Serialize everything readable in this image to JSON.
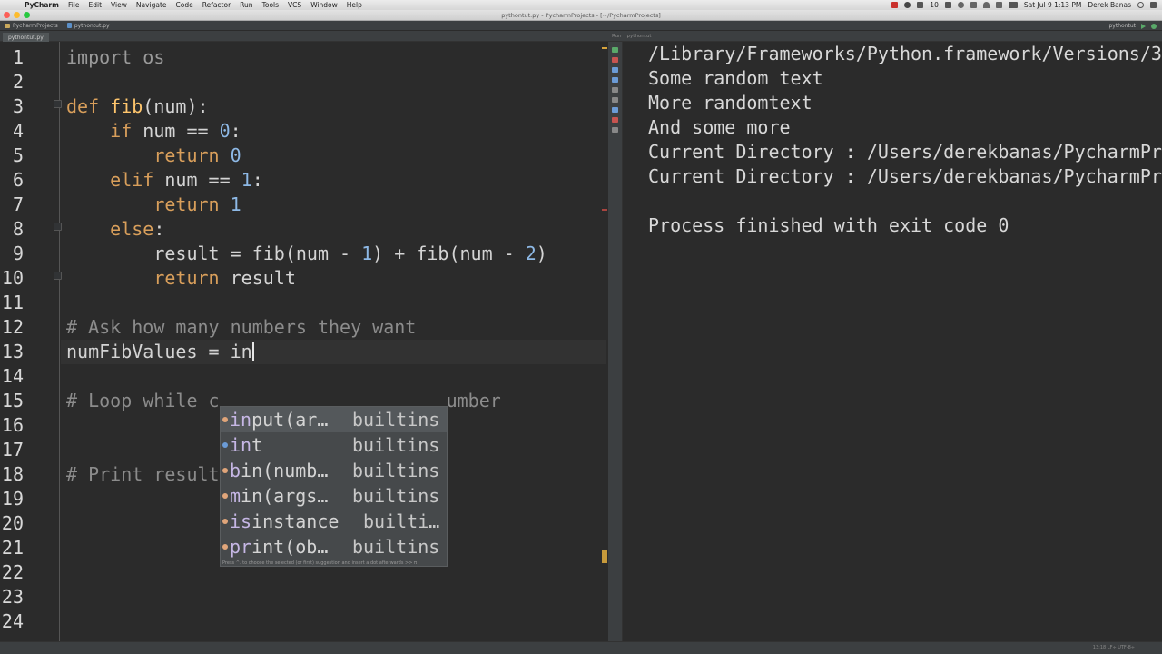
{
  "menubar": {
    "apple": "",
    "app_name": "PyCharm",
    "items": [
      "File",
      "Edit",
      "View",
      "Navigate",
      "Code",
      "Refactor",
      "Run",
      "Tools",
      "VCS",
      "Window",
      "Help"
    ],
    "status": {
      "badge": "10",
      "clock": "Sat Jul 9  1:13 PM",
      "user": "Derek Banas"
    }
  },
  "window": {
    "title": "pythontut.py - PycharmProjects - [~/PycharmProjects]"
  },
  "navbar": {
    "breadcrumbs": [
      "PycharmProjects",
      "pythontut.py"
    ],
    "run_config": "pythontut"
  },
  "editor": {
    "tab": "pythontut.py",
    "line_numbers": [
      "1",
      "2",
      "3",
      "4",
      "5",
      "6",
      "7",
      "8",
      "9",
      "10",
      "11",
      "12",
      "13",
      "14",
      "15",
      "16",
      "17",
      "18",
      "19",
      "20",
      "21",
      "22",
      "23",
      "24"
    ],
    "code": {
      "l1_kw": "import",
      "l1_rest": " os",
      "l3_kw": "def",
      "l3_fn": "fib",
      "l3_rest": "(num):",
      "l4_indent": "    ",
      "l4_kw": "if",
      "l4_mid": " num == ",
      "l4_num": "0",
      "l4_end": ":",
      "l5_indent": "        ",
      "l5_kw": "return",
      "l5_sp": " ",
      "l5_num": "0",
      "l6_indent": "    ",
      "l6_kw": "elif",
      "l6_mid": " num == ",
      "l6_num": "1",
      "l6_end": ":",
      "l7_indent": "        ",
      "l7_kw": "return",
      "l7_sp": " ",
      "l7_num": "1",
      "l8_indent": "    ",
      "l8_kw": "else",
      "l8_end": ":",
      "l9_a": "        result = fib(num - ",
      "l9_n1": "1",
      "l9_b": ") + fib(num - ",
      "l9_n2": "2",
      "l9_c": ")",
      "l10_indent": "        ",
      "l10_kw": "return",
      "l10_rest": " result",
      "l12": "# Ask how many numbers they want",
      "l13": "numFibValues = in",
      "l15_a": "# Loop while c",
      "l15_b": "umber",
      "l18": "# Print result"
    }
  },
  "autocomplete": {
    "items": [
      {
        "match": "in",
        "rest": "put(ar…",
        "source": "builtins"
      },
      {
        "match": "in",
        "rest": "t",
        "source": "builtins"
      },
      {
        "match": "b",
        "rest": "in(numb…",
        "source": "builtins"
      },
      {
        "match": "m",
        "rest": "in(args…",
        "source": "builtins"
      },
      {
        "match": "is",
        "rest": "instance",
        "source": "builti…"
      },
      {
        "match": "pr",
        "rest": "int(ob…",
        "source": "builtins"
      }
    ],
    "hint": "Press ^. to choose the selected (or first) suggestion and insert a dot afterwards  >>  π"
  },
  "run": {
    "label": "Run",
    "config": "pythontut",
    "console": [
      "/Library/Frameworks/Python.framework/Versions/3",
      "Some random text",
      "More randomtext",
      "And some more",
      "Current Directory : /Users/derekbanas/PycharmPro",
      "Current Directory : /Users/derekbanas/PycharmPro",
      "",
      "Process finished with exit code 0"
    ]
  },
  "statusbar": {
    "position": "13:18  LF÷  UTF-8÷"
  },
  "colors": {
    "keyword": "#d99f5b",
    "function": "#ffc66d",
    "number": "#8eb9e6",
    "comment": "#8c8c8c",
    "background": "#2b2b2b"
  }
}
